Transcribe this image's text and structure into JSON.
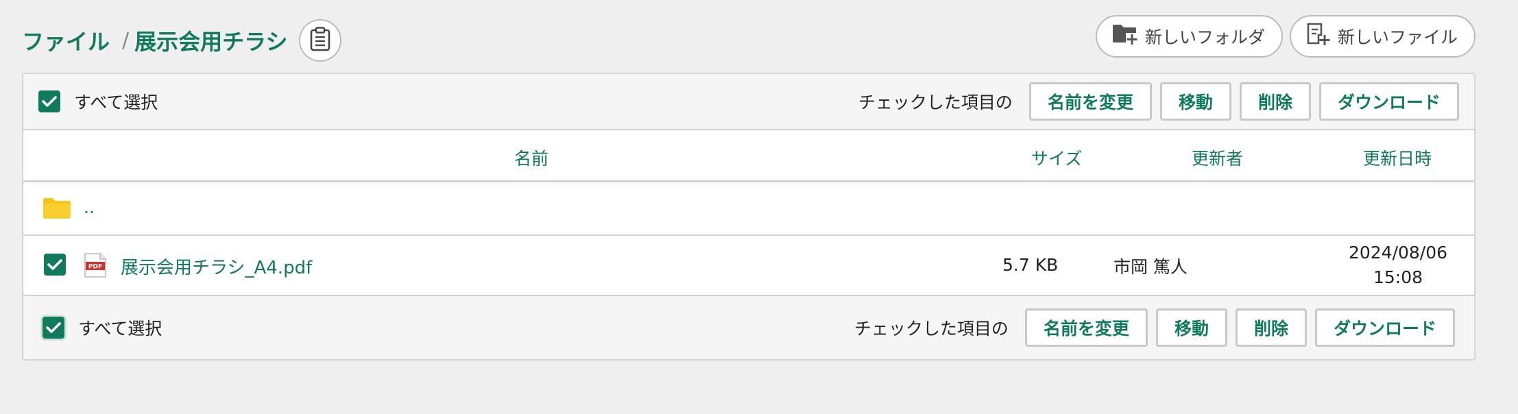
{
  "breadcrumb": {
    "root": "ファイル",
    "separator": "/",
    "current": "展示会用チラシ"
  },
  "header": {
    "new_folder_label": "新しいフォルダ",
    "new_file_label": "新しいファイル"
  },
  "toolbar": {
    "select_all_label": "すべて選択",
    "checked_items_label": "チェックした項目の",
    "rename_label": "名前を変更",
    "move_label": "移動",
    "delete_label": "削除",
    "download_label": "ダウンロード"
  },
  "table": {
    "columns": {
      "name": "名前",
      "size": "サイズ",
      "updater": "更新者",
      "updated_at": "更新日時"
    },
    "parent_link": "..",
    "files": [
      {
        "name": "展示会用チラシ_A4.pdf",
        "size": "5.7 KB",
        "updater": "市岡 篤人",
        "updated_date": "2024/08/06",
        "updated_time": "15:08",
        "icon": "pdf-file-icon",
        "checked": true
      }
    ]
  },
  "colors": {
    "accent": "#0f7a5c",
    "folder": "#f5c518",
    "pdf": "#d0312d",
    "background": "#efefef"
  }
}
